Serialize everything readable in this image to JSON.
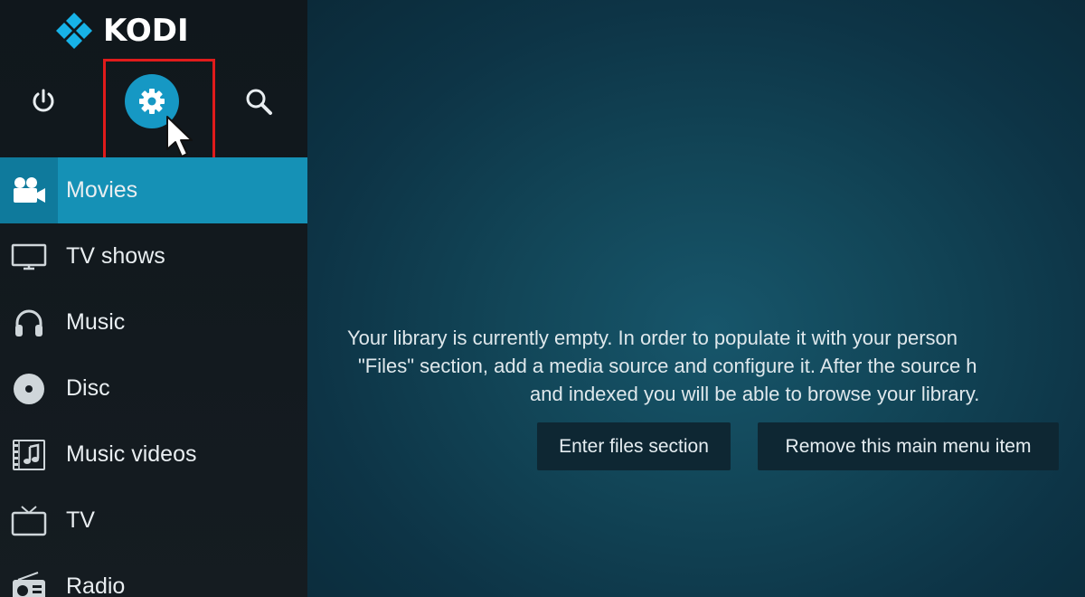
{
  "app": {
    "name": "KODI"
  },
  "top_icons": [
    "power-icon",
    "gear-icon",
    "search-icon"
  ],
  "menu": {
    "items": [
      {
        "label": "Movies",
        "icon": "movie-camera-icon",
        "active": true
      },
      {
        "label": "TV shows",
        "icon": "tv-icon",
        "active": false
      },
      {
        "label": "Music",
        "icon": "headphones-icon",
        "active": false
      },
      {
        "label": "Disc",
        "icon": "disc-icon",
        "active": false
      },
      {
        "label": "Music videos",
        "icon": "music-video-icon",
        "active": false
      },
      {
        "label": "TV",
        "icon": "live-tv-icon",
        "active": false
      },
      {
        "label": "Radio",
        "icon": "radio-icon",
        "active": false
      }
    ]
  },
  "main": {
    "message_lines": [
      "Your library is currently empty. In order to populate it with your person",
      "\"Files\" section, add a media source and configure it. After the source h",
      "and indexed you will be able to browse your library."
    ],
    "buttons": {
      "files": "Enter files section",
      "remove": "Remove this main menu item"
    }
  },
  "colors": {
    "accent": "#1591b6",
    "highlight_box": "#e01b1b",
    "sidebar_bg": "#12191e"
  }
}
